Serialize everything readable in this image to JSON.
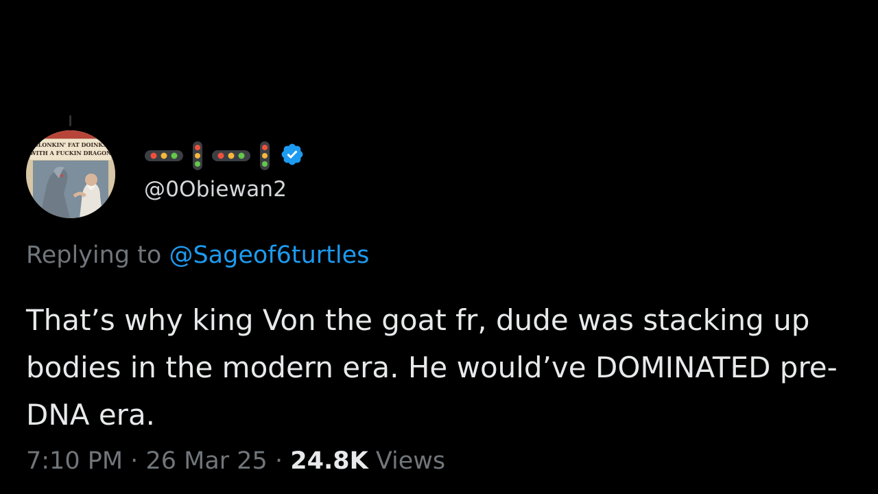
{
  "author": {
    "avatar_alt": "Choose Your Own Adventure book cover",
    "avatar_cover_lines": [
      "SLONKIN' FAT DOINKS",
      "WITH A FUCKIN DRAGON"
    ],
    "display_name_icons": [
      "horizontal-traffic-light-icon",
      "vertical-traffic-light-icon",
      "horizontal-traffic-light-icon",
      "vertical-traffic-light-icon"
    ],
    "verified": true,
    "handle": "@0Obiewan2"
  },
  "reply": {
    "prefix": "Replying to",
    "mention": "@Sageof6turtles"
  },
  "body": "That’s why king Von the goat fr, dude was stacking up bodies in the modern era. He would’ve DOMINATED pre-DNA era.",
  "meta": {
    "time": "7:10 PM",
    "separator": "·",
    "date": "26 Mar 25",
    "views_count": "24.8K",
    "views_label": "Views"
  },
  "colors": {
    "background": "#000000",
    "text": "#e7e9ea",
    "muted": "#71767b",
    "link": "#1d9bf0",
    "verified": "#1d9bf0"
  }
}
